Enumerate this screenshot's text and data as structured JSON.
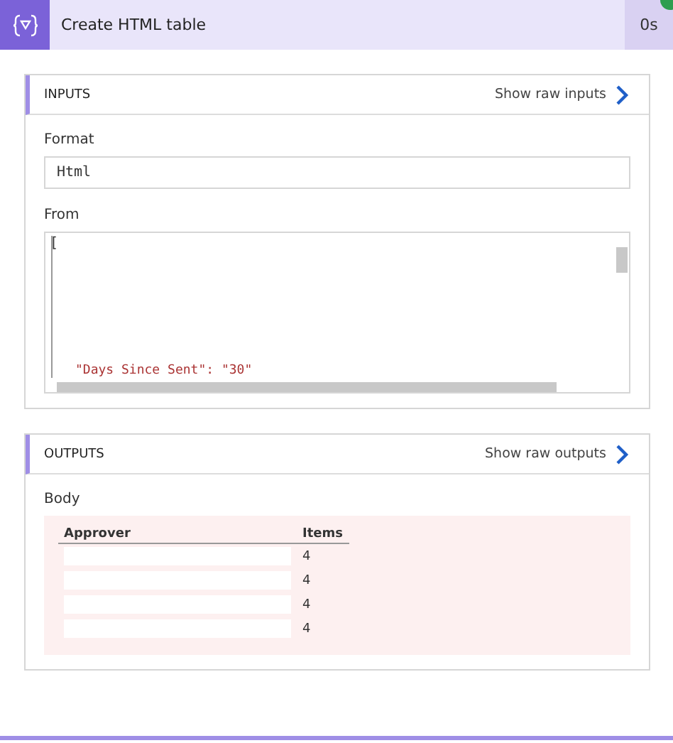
{
  "action": {
    "title": "Create HTML table",
    "duration": "0s",
    "succeeded": true
  },
  "inputs": {
    "title": "INPUTS",
    "link": "Show raw inputs",
    "format": {
      "label": "Format",
      "value": "Html"
    },
    "from": {
      "label": "From",
      "lines": [
        "[",
        "\"Days Since Sent\": \"30\""
      ]
    }
  },
  "outputs": {
    "title": "OUTPUTS",
    "link": "Show raw outputs",
    "body": {
      "label": "Body",
      "columns": [
        "Approver",
        "Items"
      ],
      "rows": [
        {
          "approver_redacted": true,
          "items": "4"
        },
        {
          "approver_redacted": true,
          "items": "4"
        },
        {
          "approver_redacted": true,
          "items": "4"
        },
        {
          "approver_redacted": true,
          "items": "4"
        }
      ]
    }
  }
}
